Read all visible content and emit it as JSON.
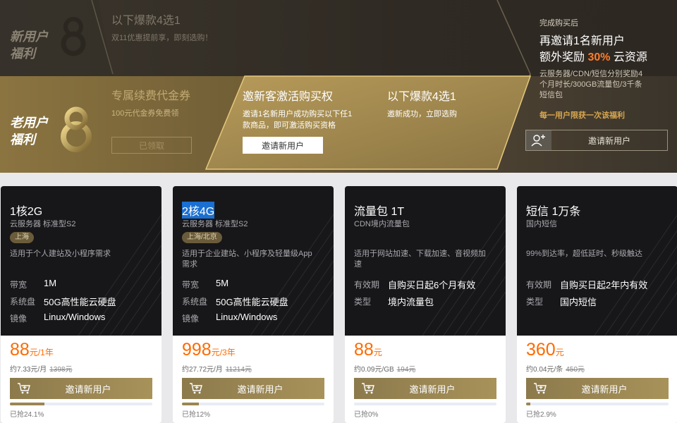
{
  "colors": {
    "accent_orange": "#ff6a00",
    "gold": "#a8925a",
    "panel_dark": "#17171a"
  },
  "banner": {
    "new_user_label": [
      "新用户",
      "福利"
    ],
    "old_user_label": [
      "老用户",
      "福利"
    ],
    "top_card": {
      "title": "以下爆款4选1",
      "subtitle": "双11优惠提前享，即刻选购！"
    },
    "renew_card": {
      "title": "专属续费代金券",
      "subtitle": "100元代金券免费领",
      "button": "已领取"
    },
    "invite_card": {
      "title": "邀新客激活购买权",
      "desc_lines": [
        "邀请1名新用户成功购买以下任1",
        "款商品，即可激活购买资格"
      ],
      "button": "邀请新用户"
    },
    "hot_card": {
      "title": "以下爆款4选1",
      "subtitle": "邀新成功，立即选购"
    },
    "right_panel": {
      "tag": "完成购买后",
      "line1": "再邀请1名新用户",
      "line2_prefix": "额外奖励 ",
      "line2_highlight": "30%",
      "line2_suffix": " 云资源",
      "desc_lines": [
        "云服务器/CDN/短信分别奖励4",
        "个月时长/300GB流量包/3千条",
        "短信包"
      ],
      "limit": "每一用户限获一次该福利",
      "button": "邀请新用户",
      "button_icon": "add-user-icon"
    }
  },
  "products": [
    {
      "title": "1核2G",
      "subtitle": "云服务器 标准型S2",
      "region": "上海",
      "desc_lines": [
        "适用于个人建站及小程序需求"
      ],
      "specs": [
        {
          "k": "带宽",
          "v": "1M"
        },
        {
          "k": "系统盘",
          "v": "50G高性能云硬盘"
        },
        {
          "k": "镜像",
          "v": "Linux/Windows"
        }
      ],
      "price": "88",
      "price_unit": "元/1年",
      "sub_price": "约7.33元/月",
      "orig": "1398元",
      "button": "邀请新用户",
      "sold_pct": 24.1,
      "sold_text": "已抢24.1%"
    },
    {
      "title": "2核4G",
      "subtitle": "云服务器 标准型S2",
      "region": "上海/北京",
      "desc_lines": [
        "适用于企业建站、小程序及轻量级App",
        "需求"
      ],
      "specs": [
        {
          "k": "带宽",
          "v": "5M"
        },
        {
          "k": "系统盘",
          "v": "50G高性能云硬盘"
        },
        {
          "k": "镜像",
          "v": "Linux/Windows"
        }
      ],
      "price": "998",
      "price_unit": "元/3年",
      "sub_price": "约27.72元/月",
      "orig": "11214元",
      "button": "邀请新用户",
      "sold_pct": 12,
      "sold_text": "已抢12%"
    },
    {
      "title": "流量包 1T",
      "subtitle": "CDN境内流量包",
      "region": "",
      "desc_lines": [
        "适用于网站加速、下载加速、音视频加",
        "速"
      ],
      "specs": [
        {
          "k": "有效期",
          "v": "自购买日起6个月有效"
        },
        {
          "k": "类型",
          "v": "境内流量包"
        }
      ],
      "price": "88",
      "price_unit": "元",
      "sub_price": "约0.09元/GB",
      "orig": "194元",
      "button": "邀请新用户",
      "sold_pct": 0,
      "sold_text": "已抢0%"
    },
    {
      "title": "短信 1万条",
      "subtitle": "国内短信",
      "region": "",
      "desc_lines": [
        "99%到达率，超低延时、秒级触达"
      ],
      "specs": [
        {
          "k": "有效期",
          "v": "自购买日起2年内有效"
        },
        {
          "k": "类型",
          "v": "国内短信"
        }
      ],
      "price": "360",
      "price_unit": "元",
      "sub_price": "约0.04元/条",
      "orig": "450元",
      "button": "邀请新用户",
      "sold_pct": 2.9,
      "sold_text": "已抢2.9%"
    }
  ]
}
